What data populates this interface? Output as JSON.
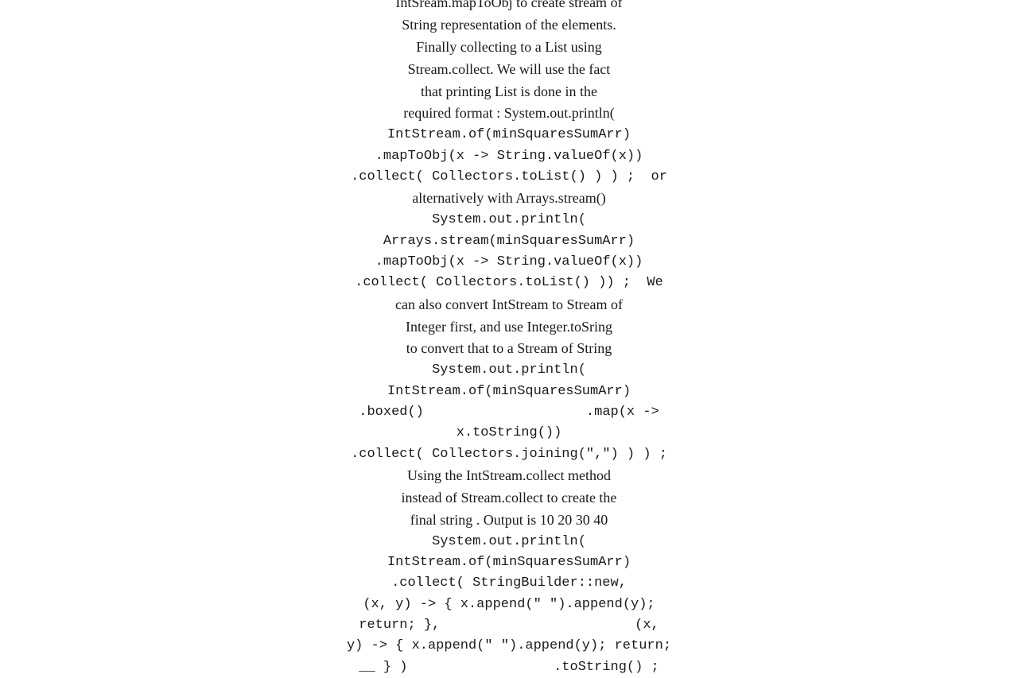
{
  "content": {
    "lines": [
      {
        "type": "regular",
        "text": "IntSream.mapToObj to create stream of"
      },
      {
        "type": "regular",
        "text": "String representation of the elements."
      },
      {
        "type": "regular",
        "text": "Finally collecting to a List using"
      },
      {
        "type": "regular",
        "text": "Stream.collect. We will use the fact"
      },
      {
        "type": "regular",
        "text": "that printing List is done in the"
      },
      {
        "type": "regular",
        "text": "required format : System.out.println("
      },
      {
        "type": "code",
        "text": "IntStream.of(minSquaresSumArr)"
      },
      {
        "type": "code",
        "text": ".mapToObj(x -> String.valueOf(x))"
      },
      {
        "type": "code",
        "text": ".collect( Collectors.toList() ) ) ;"
      },
      {
        "type": "regular",
        "text": "or alternatively with Arrays.stream()"
      },
      {
        "type": "code",
        "text": "System.out.println("
      },
      {
        "type": "code",
        "text": "Arrays.stream(minSquaresSumArr)"
      },
      {
        "type": "code",
        "text": ".mapToObj(x -> String.valueOf(x))"
      },
      {
        "type": "code",
        "text": ".collect( Collectors.toList() )) ;"
      },
      {
        "type": "regular",
        "text": "We can also convert IntStream to Stream of"
      },
      {
        "type": "regular",
        "text": "Integer first, and use Integer.toSring"
      },
      {
        "type": "regular",
        "text": "to convert that to a Stream of String"
      },
      {
        "type": "code",
        "text": "System.out.println("
      },
      {
        "type": "code",
        "text": "IntStream.of(minSquaresSumArr)"
      },
      {
        "type": "code",
        "text": ".boxed()                    .map(x ->"
      },
      {
        "type": "code",
        "text": "x.toString())"
      },
      {
        "type": "code",
        "text": ".collect( Collectors.joining(\",\") ) ) ;"
      },
      {
        "type": "regular",
        "text": "Using the IntStream.collect method"
      },
      {
        "type": "regular",
        "text": "instead of Stream.collect to create the"
      },
      {
        "type": "regular",
        "text": "final string . Output is 10 20 30 40"
      },
      {
        "type": "code",
        "text": "System.out.println("
      },
      {
        "type": "code",
        "text": "IntStream.of(minSquaresSumArr)"
      },
      {
        "type": "code",
        "text": ".collect( StringBuilder::new,"
      },
      {
        "type": "code",
        "text": "(x, y) -> { x.append(\" \").append(y);"
      },
      {
        "type": "code",
        "text": "return; },                    (x,"
      },
      {
        "type": "code",
        "text": "y) -> { x.append(\" \").append(y); return;"
      },
      {
        "type": "code",
        "text": "__ } )                  .toString() ;"
      },
      {
        "type": "regular",
        "text": "..."
      }
    ]
  }
}
